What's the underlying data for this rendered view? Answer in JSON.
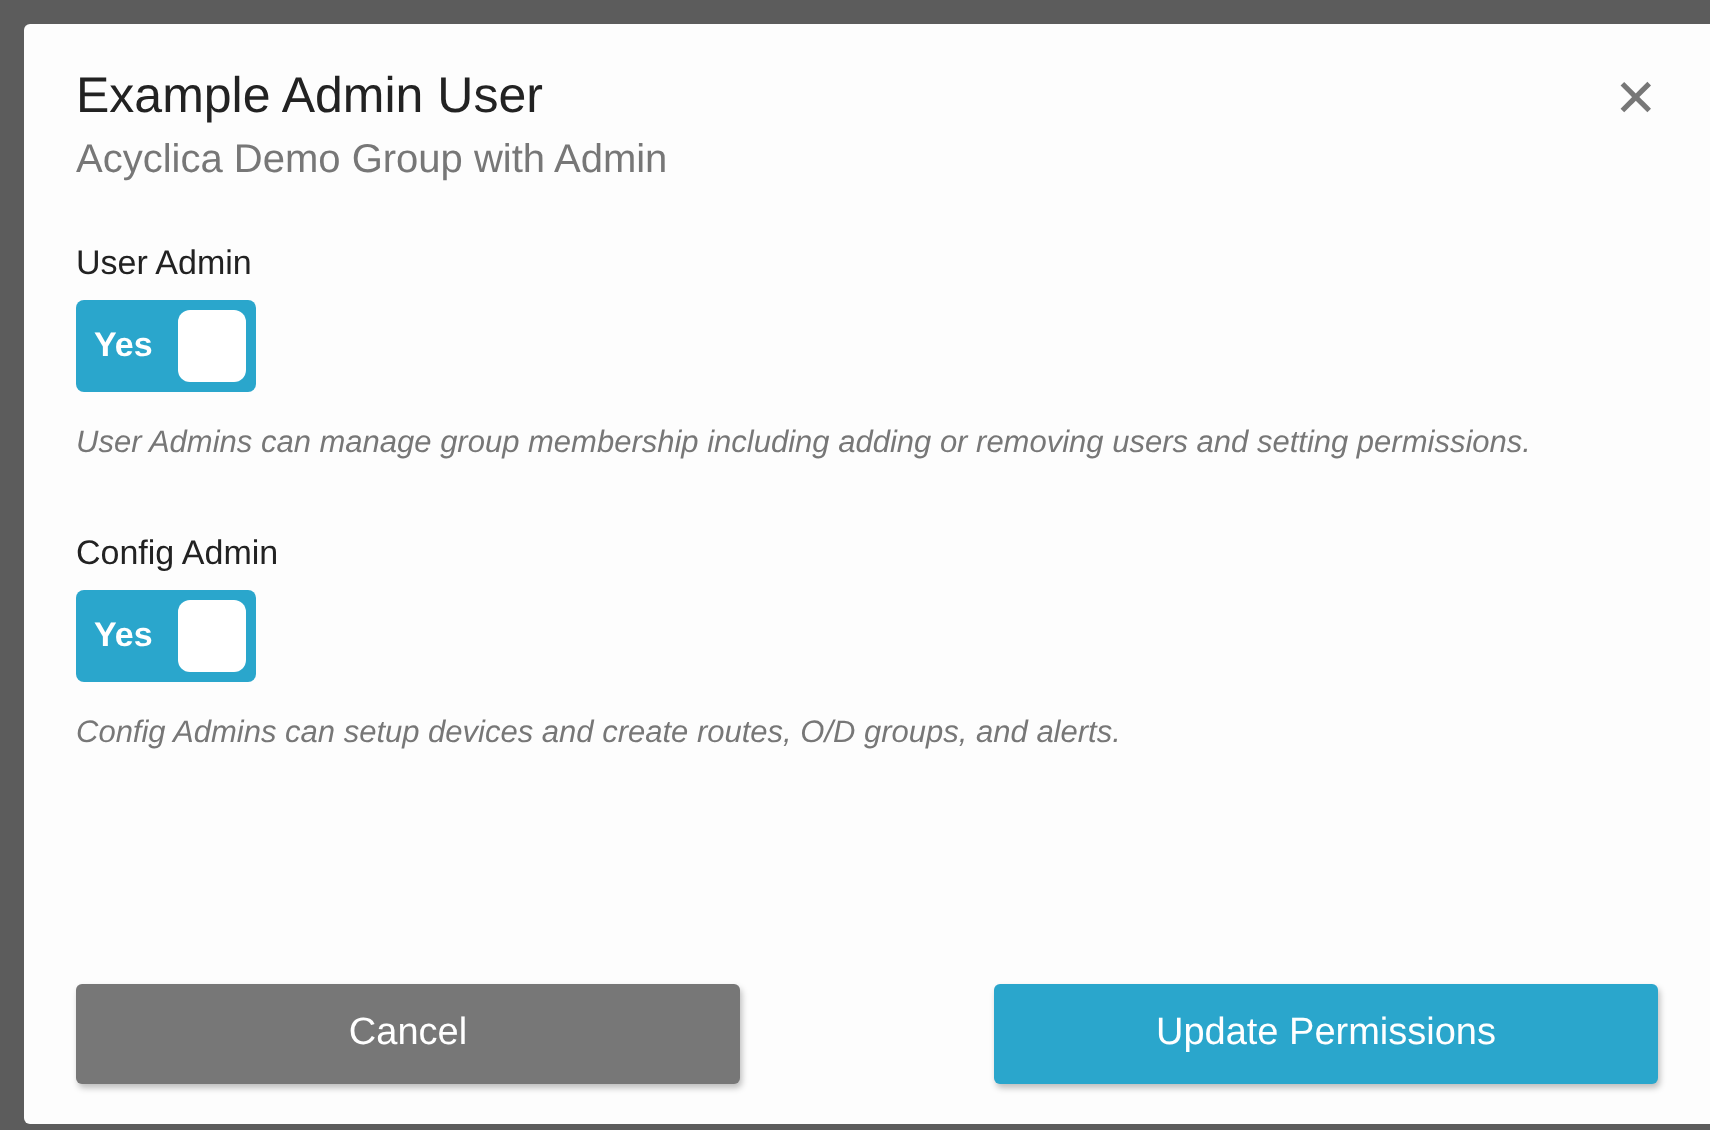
{
  "dialog": {
    "title": "Example Admin User",
    "subtitle": "Acyclica Demo Group with Admin",
    "close": "✕"
  },
  "settings": [
    {
      "label": "User Admin",
      "on": true,
      "toggle_text": "Yes",
      "description": "User Admins can manage group membership including adding or removing users and setting permissions."
    },
    {
      "label": "Config Admin",
      "on": true,
      "toggle_text": "Yes",
      "description": "Config Admins can setup devices and create routes, O/D groups, and alerts."
    }
  ],
  "buttons": [
    {
      "label": "Cancel",
      "kind": "secondary"
    },
    {
      "label": "Update Permissions",
      "kind": "primary"
    }
  ]
}
